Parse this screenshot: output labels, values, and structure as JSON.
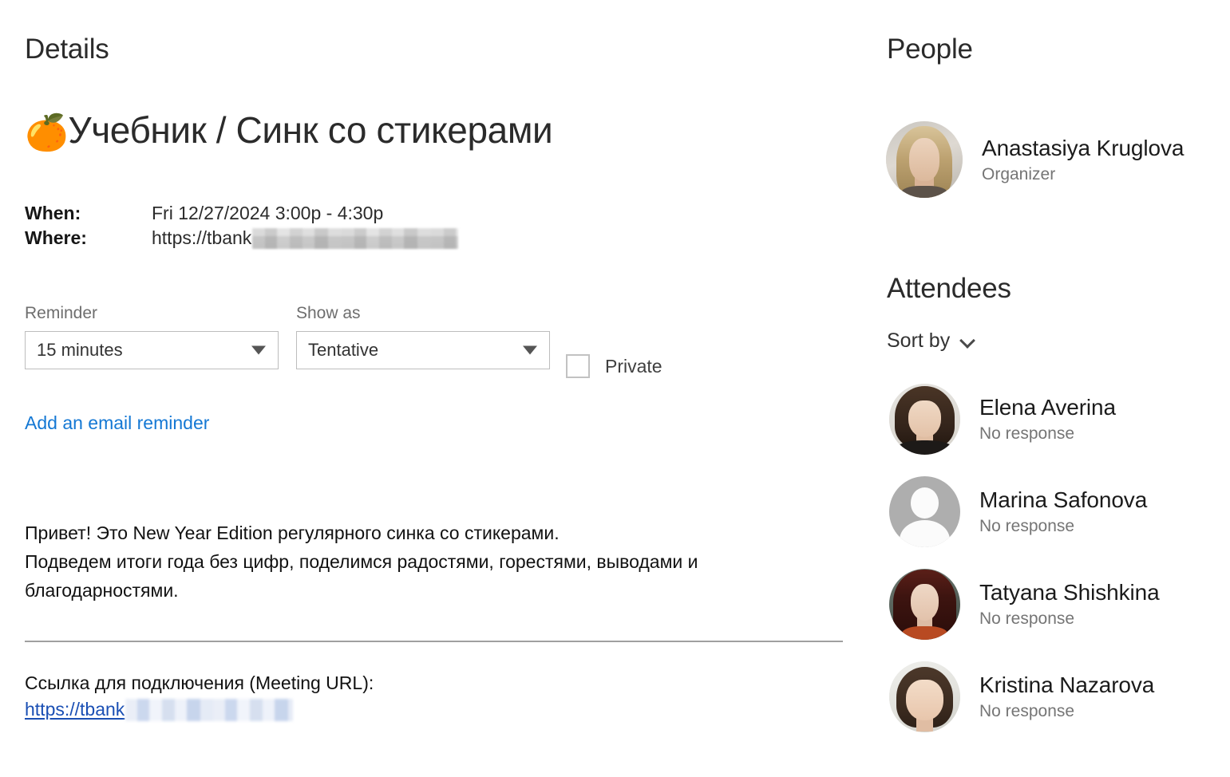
{
  "details": {
    "heading": "Details",
    "title_emoji": "🍊",
    "title_text": "Учебник / Синк со стикерами",
    "when_label": "When:",
    "when_value": "Fri 12/27/2024 3:00p - 4:30p",
    "where_label": "Where:",
    "where_value": "https://tbank",
    "where_redacted": true
  },
  "form": {
    "reminder_label": "Reminder",
    "reminder_value": "15 minutes",
    "reminder_options": [
      "15 minutes"
    ],
    "show_as_label": "Show as",
    "show_as_value": "Tentative",
    "show_as_options": [
      "Tentative"
    ],
    "private_label": "Private",
    "private_checked": false,
    "email_reminder_link": "Add an email reminder"
  },
  "body": {
    "line1": "Привет! Это New Year Edition регулярного синка со стикерами.",
    "line2": "Подведем итоги года без цифр, поделимся радостями, горестями, выводами и",
    "line3": "благодарностями."
  },
  "meeting": {
    "caption": "Ссылка для подключения (Meeting URL):",
    "url_visible": "https://tbank",
    "url_redacted": true
  },
  "people": {
    "heading": "People",
    "organizer": {
      "name": "Anastasiya Kruglova",
      "role": "Organizer",
      "avatar": "photo-avatar-anastasiya"
    }
  },
  "attendees": {
    "heading": "Attendees",
    "sort_by_label": "Sort by",
    "sort_by_icon": "chevron-down-icon",
    "list": [
      {
        "name": "Elena Averina",
        "status": "No response",
        "avatar": "photo-avatar-elena"
      },
      {
        "name": "Marina Safonova",
        "status": "No response",
        "avatar": "person-placeholder-icon"
      },
      {
        "name": "Tatyana Shishkina",
        "status": "No response",
        "avatar": "photo-avatar-tatyana"
      },
      {
        "name": "Kristina Nazarova",
        "status": "No response",
        "avatar": "photo-avatar-kristina"
      }
    ]
  },
  "colors": {
    "link_blue": "#1478d4",
    "url_blue": "#1a4fb4",
    "text_primary": "#1b1b1b",
    "text_muted": "#757575",
    "border": "#bdbdbd",
    "divider": "#a0a0a0",
    "background": "#ffffff"
  }
}
